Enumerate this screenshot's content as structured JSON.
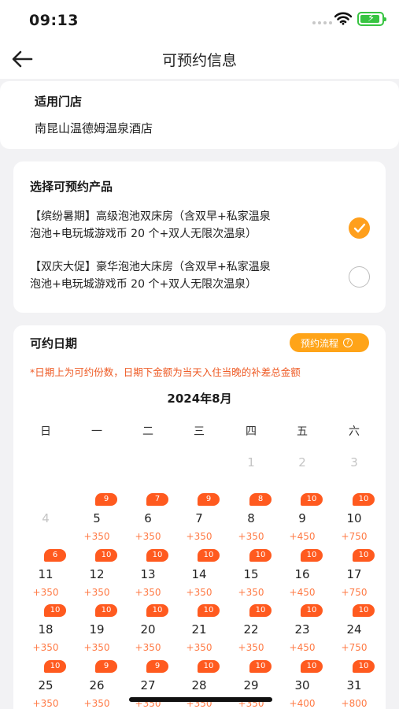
{
  "status_bar": {
    "time": "09:13"
  },
  "nav": {
    "title": "可预约信息"
  },
  "store": {
    "label": "适用门店",
    "name": "南昆山温德姆温泉酒店"
  },
  "products": {
    "title": "选择可预约产品",
    "items": [
      {
        "line1": "【缤纷暑期】高级泡池双床房（含双早+私家温泉",
        "line2": "泡池+电玩城游戏币 20 个+双人无限次温泉）",
        "selected": true
      },
      {
        "line1": "【双庆大促】豪华泡池大床房（含双早+私家温泉",
        "line2": "泡池+电玩城游戏币 20 个+双人无限次温泉）",
        "selected": false
      }
    ]
  },
  "dates": {
    "title": "可约日期",
    "flow_label": "预约流程",
    "note": "*日期上为可约份数，日期下金额为当天入住当晚的补差总金额",
    "month": "2024年8月",
    "weekdays": [
      "日",
      "一",
      "二",
      "三",
      "四",
      "五",
      "六"
    ],
    "rows": [
      [
        null,
        null,
        null,
        null,
        {
          "d": "1",
          "dim": true
        },
        {
          "d": "2",
          "dim": true
        },
        {
          "d": "3",
          "dim": true
        }
      ],
      [
        {
          "d": "4",
          "dim": true
        },
        {
          "d": "5",
          "n": "9",
          "p": "+350"
        },
        {
          "d": "6",
          "n": "7",
          "p": "+350"
        },
        {
          "d": "7",
          "n": "9",
          "p": "+350"
        },
        {
          "d": "8",
          "n": "8",
          "p": "+350"
        },
        {
          "d": "9",
          "n": "10",
          "p": "+450"
        },
        {
          "d": "10",
          "n": "10",
          "p": "+750"
        }
      ],
      [
        {
          "d": "11",
          "n": "6",
          "p": "+350"
        },
        {
          "d": "12",
          "n": "10",
          "p": "+350"
        },
        {
          "d": "13",
          "n": "10",
          "p": "+350"
        },
        {
          "d": "14",
          "n": "10",
          "p": "+350"
        },
        {
          "d": "15",
          "n": "10",
          "p": "+350"
        },
        {
          "d": "16",
          "n": "10",
          "p": "+450"
        },
        {
          "d": "17",
          "n": "10",
          "p": "+750"
        }
      ],
      [
        {
          "d": "18",
          "n": "10",
          "p": "+350"
        },
        {
          "d": "19",
          "n": "10",
          "p": "+350"
        },
        {
          "d": "20",
          "n": "10",
          "p": "+350"
        },
        {
          "d": "21",
          "n": "10",
          "p": "+350"
        },
        {
          "d": "22",
          "n": "10",
          "p": "+350"
        },
        {
          "d": "23",
          "n": "10",
          "p": "+450"
        },
        {
          "d": "24",
          "n": "10",
          "p": "+750"
        }
      ],
      [
        {
          "d": "25",
          "n": "10",
          "p": "+350"
        },
        {
          "d": "26",
          "n": "9",
          "p": "+350"
        },
        {
          "d": "27",
          "n": "9",
          "p": "+350"
        },
        {
          "d": "28",
          "n": "10",
          "p": "+350"
        },
        {
          "d": "29",
          "n": "10",
          "p": "+350"
        },
        {
          "d": "30",
          "n": "10",
          "p": "+400"
        },
        {
          "d": "31",
          "n": "10",
          "p": "+800"
        }
      ]
    ]
  },
  "colors": {
    "accent": "#ffa418",
    "badge": "#ff5a1f",
    "price": "#ff7a45",
    "note": "#ee5a24"
  },
  "icons": [
    "back-arrow-icon",
    "wifi-icon",
    "battery-charging-icon",
    "check-icon",
    "question-icon"
  ]
}
